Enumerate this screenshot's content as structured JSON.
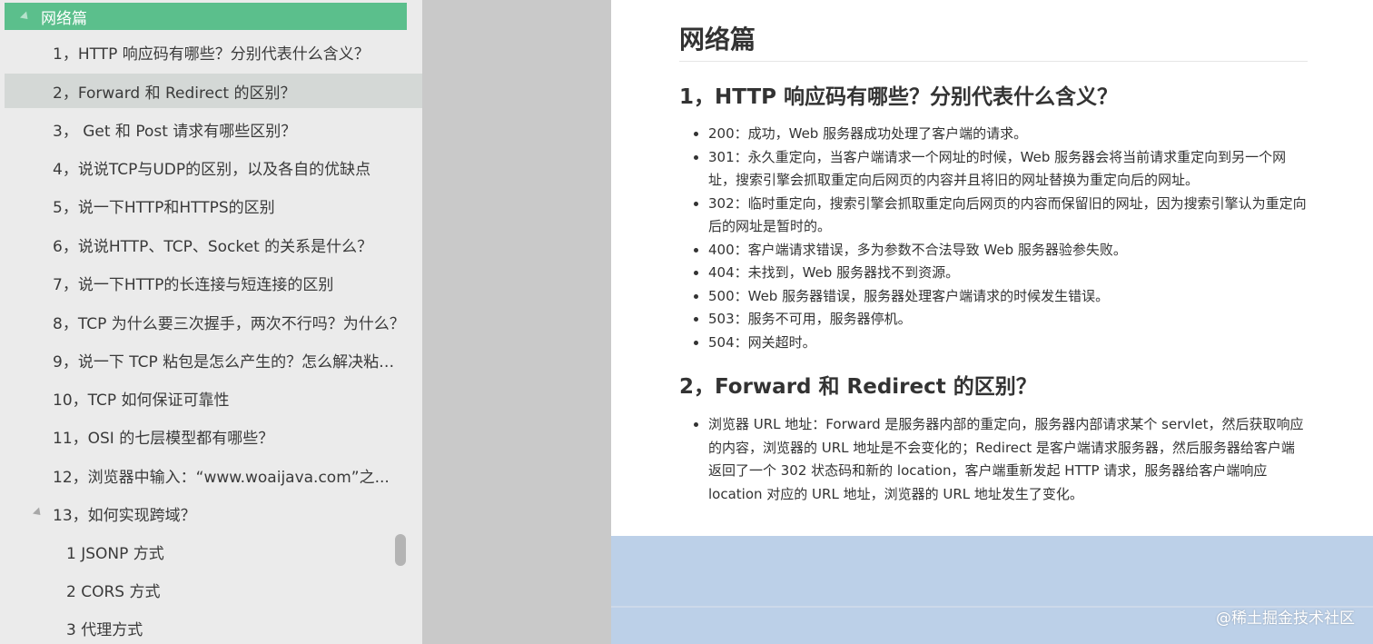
{
  "sidebar": {
    "section_title": "网络篇",
    "items": [
      {
        "label": "1，HTTP 响应码有哪些？分别代表什么含义？"
      },
      {
        "label": "2，Forward 和 Redirect 的区别？",
        "active": true
      },
      {
        "label": "3， Get 和 Post 请求有哪些区别？"
      },
      {
        "label": "4，说说TCP与UDP的区别，以及各自的优缺点"
      },
      {
        "label": "5，说一下HTTP和HTTPS的区别"
      },
      {
        "label": "6，说说HTTP、TCP、Socket 的关系是什么？"
      },
      {
        "label": "7，说一下HTTP的长连接与短连接的区别"
      },
      {
        "label": "8，TCP 为什么要三次握手，两次不行吗？为什么？"
      },
      {
        "label": "9，说一下 TCP 粘包是怎么产生的？怎么解决粘包..."
      },
      {
        "label": "10，TCP 如何保证可靠性"
      },
      {
        "label": "11，OSI 的七层模型都有哪些？"
      },
      {
        "label": "12，浏览器中输入：“www.woaijava.com”之..."
      },
      {
        "label": "13，如何实现跨域？",
        "expanded": true
      },
      {
        "label": "1 JSONP 方式"
      },
      {
        "label": "2 CORS 方式"
      },
      {
        "label": "3 代理方式"
      }
    ]
  },
  "content": {
    "title": "网络篇",
    "sections": [
      {
        "heading": "1，HTTP 响应码有哪些？分别代表什么含义？",
        "bullets": [
          "200：成功，Web 服务器成功处理了客户端的请求。",
          "301：永久重定向，当客户端请求一个网址的时候，Web 服务器会将当前请求重定向到另一个网址，搜索引擎会抓取重定向后网页的内容并且将旧的网址替换为重定向后的网址。",
          "302：临时重定向，搜索引擎会抓取重定向后网页的内容而保留旧的网址，因为搜索引擎认为重定向后的网址是暂时的。",
          "400：客户端请求错误，多为参数不合法导致 Web 服务器验参失败。",
          "404：未找到，Web 服务器找不到资源。",
          "500：Web 服务器错误，服务器处理客户端请求的时候发生错误。",
          "503：服务不可用，服务器停机。",
          "504：网关超时。"
        ]
      },
      {
        "heading": "2，Forward 和 Redirect 的区别？",
        "bullets": [
          "浏览器 URL 地址：Forward 是服务器内部的重定向，服务器内部请求某个 servlet，然后获取响应的内容，浏览器的 URL 地址是不会变化的；Redirect 是客户端请求服务器，然后服务器给客户端返回了一个 302 状态码和新的 location，客户端重新发起 HTTP 请求，服务器给客户端响应 location 对应的 URL 地址，浏览器的 URL 地址发生了变化。"
        ]
      }
    ]
  },
  "footer": {
    "credit": "@稀土掘金技术社区"
  },
  "colors": {
    "sidebar_bg": "#ebebeb",
    "section_highlight": "#5bbf8c",
    "active_item": "#d4d8d6",
    "gutter": "#c9c9c9",
    "bottom_band": "#bcd0e8"
  }
}
